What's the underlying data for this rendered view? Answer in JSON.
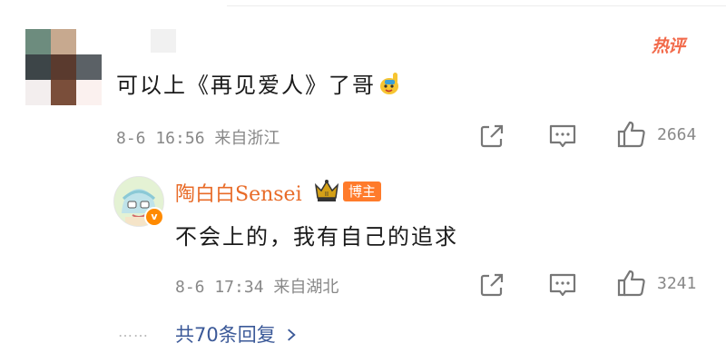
{
  "comment": {
    "text": "可以上《再见爱人》了哥",
    "emoji_icon": "raising-hand-emoji",
    "hot_label": "热评",
    "timestamp": "8-6 16:56",
    "location": "来自浙江",
    "likes": "2664"
  },
  "reply": {
    "author": "陶白白Sensei",
    "tag": "博主",
    "text": "不会上的，我有自己的追求",
    "timestamp": "8-6 17:34",
    "location": "来自湖北",
    "likes": "3241"
  },
  "thread": {
    "dots": "……",
    "more_label": "共70条回复"
  },
  "icons": {
    "share": "share-icon",
    "comment": "comment-icon",
    "like": "thumbs-up-icon"
  },
  "colors": {
    "accent_orange": "#e86b28",
    "hot_red": "#f26a4b",
    "link_blue": "#3b5998",
    "meta_gray": "#888888"
  }
}
